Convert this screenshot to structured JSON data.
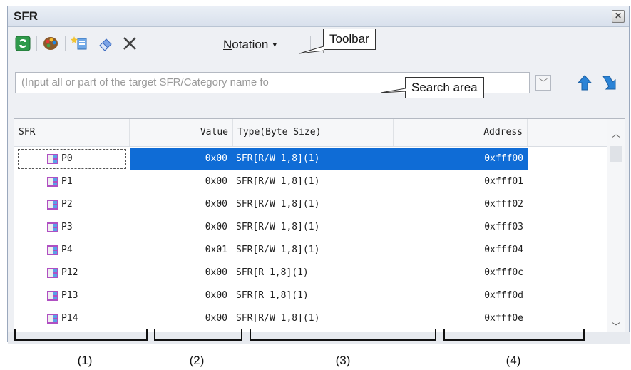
{
  "window": {
    "title": "SFR"
  },
  "toolbar": {
    "notation_label": "Notation",
    "notation_accesskey": "N",
    "notation_rest": "otation"
  },
  "callouts": {
    "toolbar": "Toolbar",
    "search_area": "Search area"
  },
  "search": {
    "placeholder": "(Input all or part of the target SFR/Category name fo"
  },
  "columns": {
    "sfr": "SFR",
    "value": "Value",
    "type": "Type(Byte Size)",
    "address": "Address"
  },
  "rows": [
    {
      "name": "P0",
      "value": "0x00",
      "type": "SFR[R/W 1,8](1)",
      "address": "0xfff00",
      "selected": true
    },
    {
      "name": "P1",
      "value": "0x00",
      "type": "SFR[R/W 1,8](1)",
      "address": "0xfff01"
    },
    {
      "name": "P2",
      "value": "0x00",
      "type": "SFR[R/W 1,8](1)",
      "address": "0xfff02"
    },
    {
      "name": "P3",
      "value": "0x00",
      "type": "SFR[R/W 1,8](1)",
      "address": "0xfff03"
    },
    {
      "name": "P4",
      "value": "0x01",
      "type": "SFR[R/W 1,8](1)",
      "address": "0xfff04"
    },
    {
      "name": "P12",
      "value": "0x00",
      "type": "SFR[R 1,8](1)",
      "address": "0xfff0c"
    },
    {
      "name": "P13",
      "value": "0x00",
      "type": "SFR[R 1,8](1)",
      "address": "0xfff0d"
    },
    {
      "name": "P14",
      "value": "0x00",
      "type": "SFR[R/W 1,8](1)",
      "address": "0xfff0e"
    }
  ],
  "section_labels": [
    "(1)",
    "(2)",
    "(3)",
    "(4)"
  ],
  "icons": {
    "refresh": "refresh-icon",
    "color": "color-palette-icon",
    "watch": "add-watch-icon",
    "eraser": "eraser-icon",
    "delete": "delete-icon",
    "search_up": "search-up-arrow-icon",
    "search_down": "search-down-arrow-icon",
    "register": "register-icon"
  },
  "colors": {
    "selection": "#0f6cd6",
    "accent_blue": "#2a83d6"
  }
}
